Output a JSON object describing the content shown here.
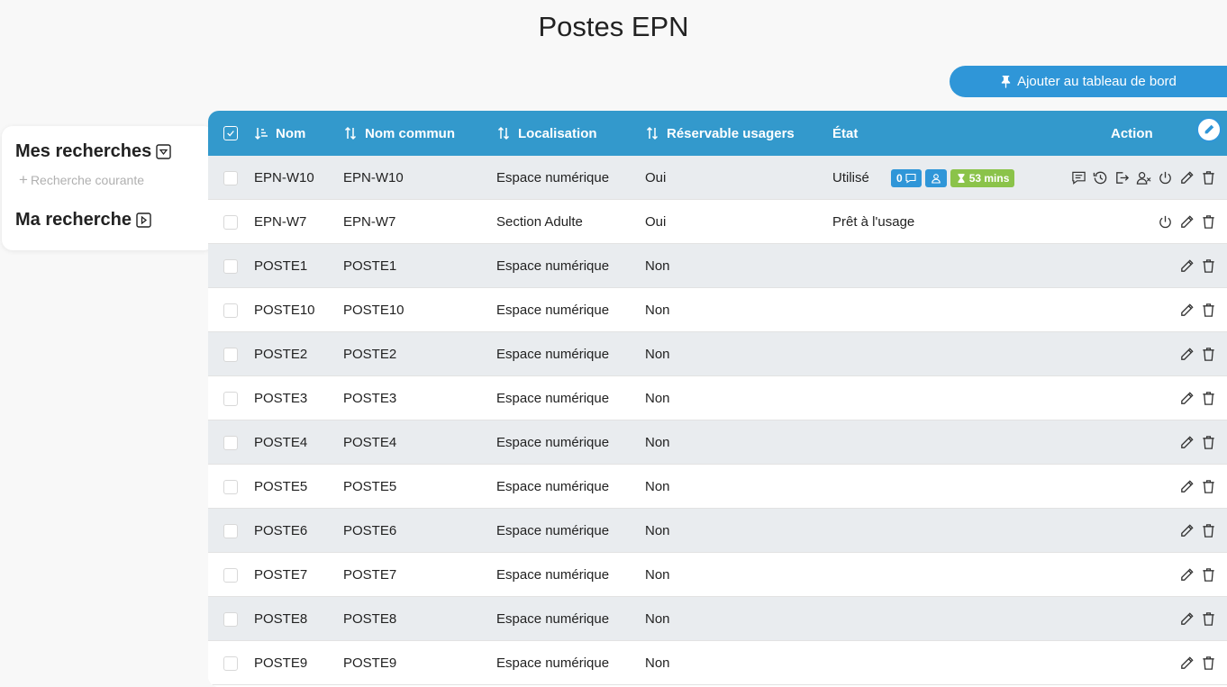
{
  "page": {
    "title": "Postes EPN"
  },
  "dashboard_button": {
    "label": "Ajouter au tableau de bord",
    "icon": "pin-icon"
  },
  "sidebar": {
    "my_searches": "Mes recherches",
    "current_search": "Recherche courante",
    "my_search": "Ma recherche"
  },
  "table": {
    "columns": {
      "nom": "Nom",
      "nom_commun": "Nom commun",
      "localisation": "Localisation",
      "reservable": "Réservable usagers",
      "etat": "État",
      "action": "Action"
    },
    "rows": [
      {
        "nom": "EPN-W10",
        "nom_commun": "EPN-W10",
        "localisation": "Espace numérique",
        "reservable": "Oui",
        "etat": "Utilisé",
        "badges": {
          "messages": "0",
          "time": "53 mins"
        },
        "actions": [
          "message-icon",
          "history-icon",
          "logout-icon",
          "remove-user-icon",
          "power-icon",
          "edit-icon",
          "delete-icon"
        ]
      },
      {
        "nom": "EPN-W7",
        "nom_commun": "EPN-W7",
        "localisation": "Section Adulte",
        "reservable": "Oui",
        "etat": "Prêt à l'usage",
        "actions": [
          "power-icon",
          "edit-icon",
          "delete-icon"
        ]
      },
      {
        "nom": "POSTE1",
        "nom_commun": "POSTE1",
        "localisation": "Espace numérique",
        "reservable": "Non",
        "etat": "",
        "actions": [
          "edit-icon",
          "delete-icon"
        ]
      },
      {
        "nom": "POSTE10",
        "nom_commun": "POSTE10",
        "localisation": "Espace numérique",
        "reservable": "Non",
        "etat": "",
        "actions": [
          "edit-icon",
          "delete-icon"
        ]
      },
      {
        "nom": "POSTE2",
        "nom_commun": "POSTE2",
        "localisation": "Espace numérique",
        "reservable": "Non",
        "etat": "",
        "actions": [
          "edit-icon",
          "delete-icon"
        ]
      },
      {
        "nom": "POSTE3",
        "nom_commun": "POSTE3",
        "localisation": "Espace numérique",
        "reservable": "Non",
        "etat": "",
        "actions": [
          "edit-icon",
          "delete-icon"
        ]
      },
      {
        "nom": "POSTE4",
        "nom_commun": "POSTE4",
        "localisation": "Espace numérique",
        "reservable": "Non",
        "etat": "",
        "actions": [
          "edit-icon",
          "delete-icon"
        ]
      },
      {
        "nom": "POSTE5",
        "nom_commun": "POSTE5",
        "localisation": "Espace numérique",
        "reservable": "Non",
        "etat": "",
        "actions": [
          "edit-icon",
          "delete-icon"
        ]
      },
      {
        "nom": "POSTE6",
        "nom_commun": "POSTE6",
        "localisation": "Espace numérique",
        "reservable": "Non",
        "etat": "",
        "actions": [
          "edit-icon",
          "delete-icon"
        ]
      },
      {
        "nom": "POSTE7",
        "nom_commun": "POSTE7",
        "localisation": "Espace numérique",
        "reservable": "Non",
        "etat": "",
        "actions": [
          "edit-icon",
          "delete-icon"
        ]
      },
      {
        "nom": "POSTE8",
        "nom_commun": "POSTE8",
        "localisation": "Espace numérique",
        "reservable": "Non",
        "etat": "",
        "actions": [
          "edit-icon",
          "delete-icon"
        ]
      },
      {
        "nom": "POSTE9",
        "nom_commun": "POSTE9",
        "localisation": "Espace numérique",
        "reservable": "Non",
        "etat": "",
        "actions": [
          "edit-icon",
          "delete-icon"
        ]
      }
    ]
  },
  "colors": {
    "accent": "#3399cc",
    "button": "#2f96d8",
    "badge_green": "#8bc34a",
    "row_alt": "#e9ecef"
  }
}
